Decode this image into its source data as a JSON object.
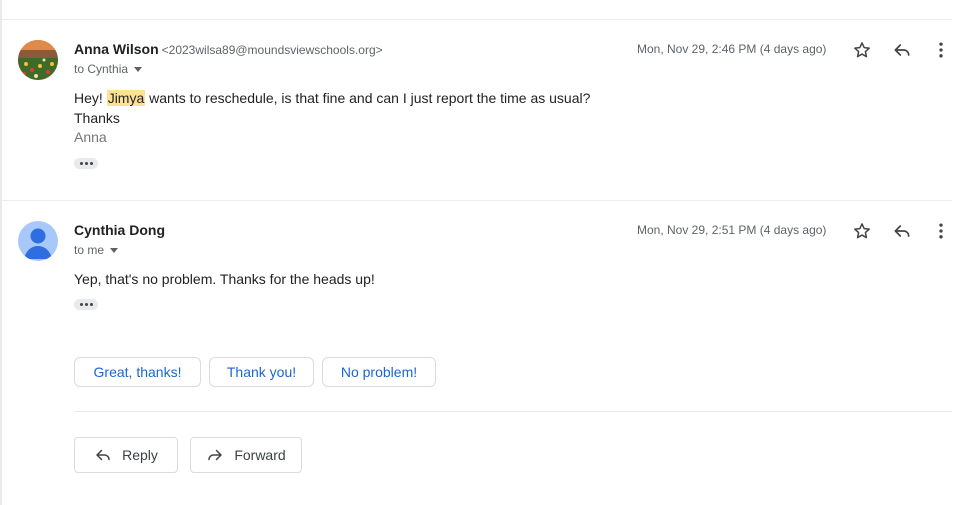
{
  "messages": [
    {
      "sender_name": "Anna Wilson",
      "sender_email": "<2023wilsa89@moundsviewschools.org>",
      "recipient": "to Cynthia",
      "date": "Mon, Nov 29, 2:46 PM (4 days ago)",
      "body": {
        "line1_before": "Hey! ",
        "line1_highlight": "Jimya",
        "line1_after": " wants to reschedule, is that fine and can I just report the time as usual?",
        "line2": "Thanks",
        "signature": "Anna"
      }
    },
    {
      "sender_name": "Cynthia Dong",
      "recipient": "to me",
      "date": "Mon, Nov 29, 2:51 PM (4 days ago)",
      "body": {
        "line1": "Yep, that's no problem. Thanks for the heads up!"
      }
    }
  ],
  "smart_replies": [
    "Great, thanks!",
    "Thank you!",
    "No problem!"
  ],
  "actions": {
    "reply": "Reply",
    "forward": "Forward"
  },
  "colors": {
    "highlight": "#fde293",
    "chip_text": "#1967d2",
    "avatar_default": "#a8c7fa"
  },
  "icons": [
    "star-icon",
    "reply-icon",
    "more-vert-icon",
    "forward-icon"
  ]
}
